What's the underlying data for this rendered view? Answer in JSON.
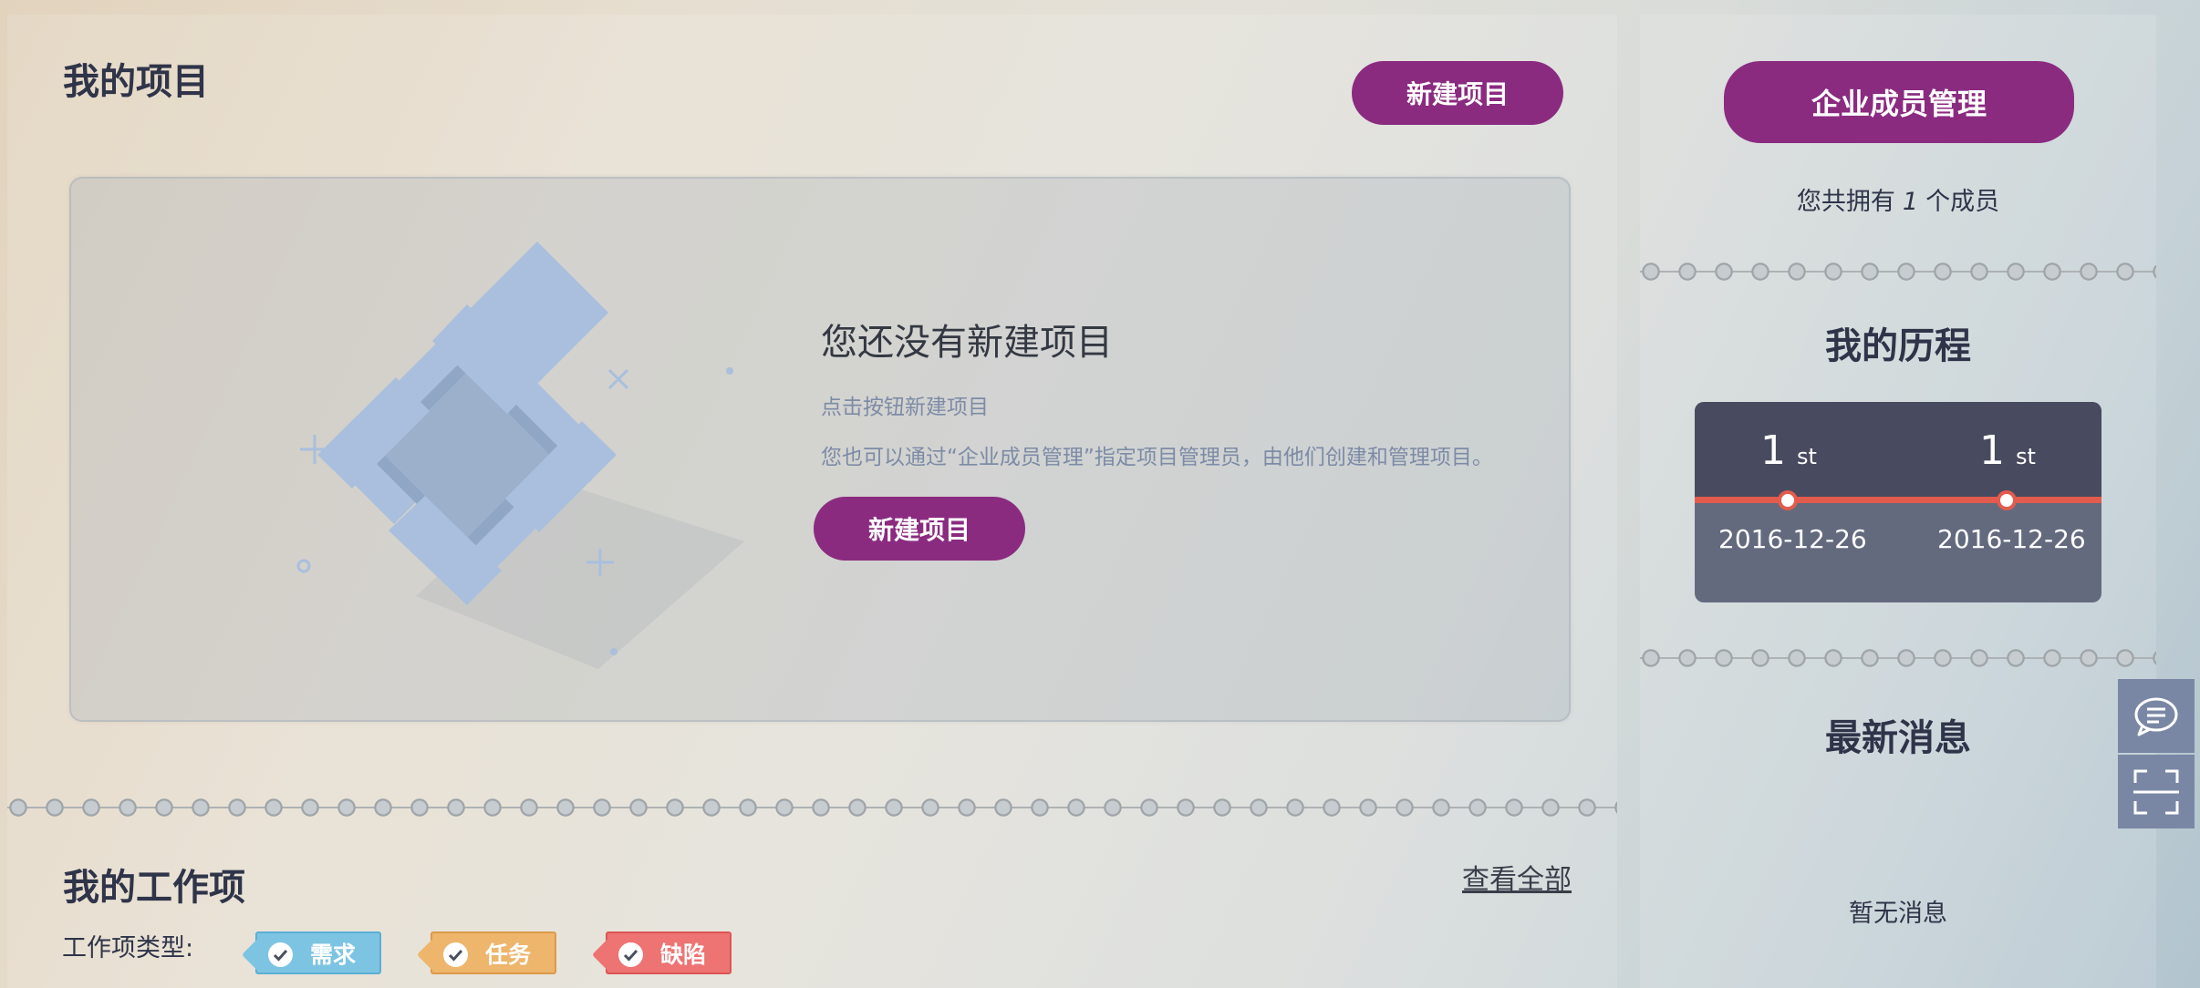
{
  "projects": {
    "title": "我的项目",
    "new_button": "新建项目",
    "empty": {
      "title": "您还没有新建项目",
      "hint_click": "点击按钮新建项目",
      "hint_manage": "您也可以通过“企业成员管理”指定项目管理员，由他们创建和管理项目。",
      "button": "新建项目"
    }
  },
  "work_items": {
    "title": "我的工作项",
    "view_all": "查看全部",
    "type_label": "工作项类型:",
    "types": [
      {
        "label": "需求",
        "color": "#7dc4e3"
      },
      {
        "label": "任务",
        "color": "#eeb56c"
      },
      {
        "label": "缺陷",
        "color": "#ee7373"
      }
    ]
  },
  "sidebar": {
    "member_button": "企业成员管理",
    "member_prefix": "您共拥有",
    "member_count": "1",
    "member_suffix": "个成员",
    "history_title": "我的历程",
    "timeline": [
      {
        "rank": "1",
        "suffix": "st",
        "date": "2016-12-26"
      },
      {
        "rank": "1",
        "suffix": "st",
        "date": "2016-12-26"
      }
    ],
    "news_title": "最新消息",
    "no_news": "暂无消息"
  },
  "float_tools": {
    "chat_icon": "chat-bubble-icon",
    "scan_icon": "scan-frame-icon"
  },
  "colors": {
    "accent": "#8a2b80",
    "timeline_dark": "#484b5f",
    "timeline_light": "#646a7e",
    "timeline_line": "#e25b4c"
  }
}
